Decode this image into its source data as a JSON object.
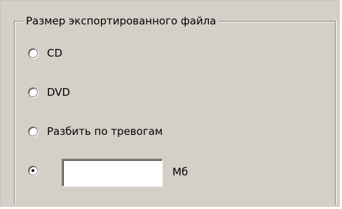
{
  "export_size_group": {
    "title": "Размер экспортированного файла",
    "options": [
      {
        "label": "CD",
        "selected": false
      },
      {
        "label": "DVD",
        "selected": false
      },
      {
        "label": "Разбить по тревогам",
        "selected": false
      },
      {
        "label": "",
        "selected": true
      }
    ],
    "custom_size": {
      "value": "",
      "unit": "Мб"
    }
  }
}
